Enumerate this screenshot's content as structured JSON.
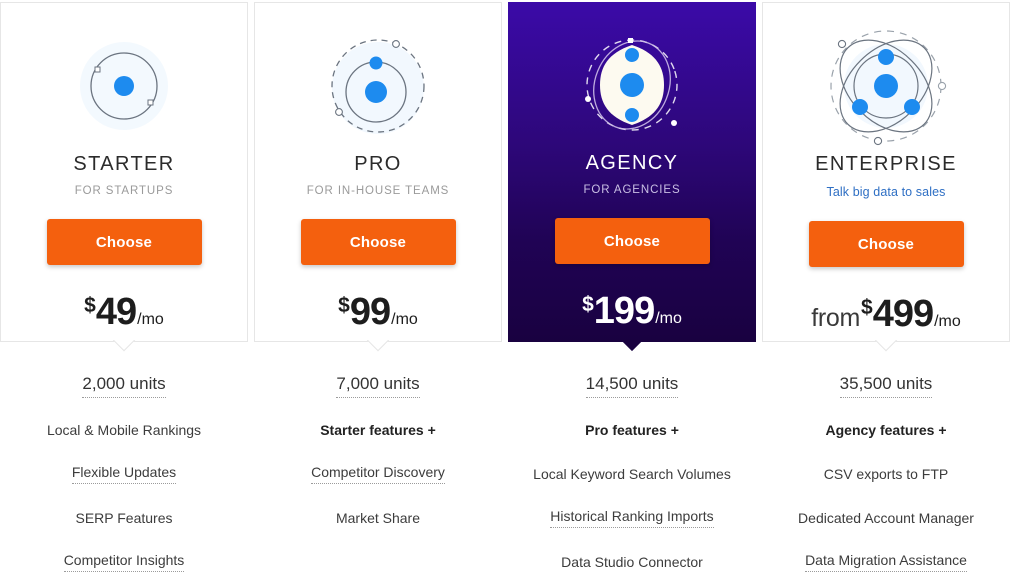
{
  "plans": [
    {
      "id": "starter",
      "icon": "atom-1-electron-icon",
      "name": "STARTER",
      "tagline": "FOR STARTUPS",
      "tagline_is_link": false,
      "cta": "Choose",
      "price_from": "",
      "currency": "$",
      "amount": "49",
      "period": "/mo",
      "featured": false,
      "features": [
        {
          "text": "2,000 units",
          "style": "units",
          "tooltip": true
        },
        {
          "text": "Local & Mobile Rankings",
          "style": "normal",
          "tooltip": false
        },
        {
          "text": "Flexible Updates",
          "style": "normal",
          "tooltip": true
        },
        {
          "text": "SERP Features",
          "style": "normal",
          "tooltip": false
        },
        {
          "text": "Competitor Insights",
          "style": "normal",
          "tooltip": true
        }
      ]
    },
    {
      "id": "pro",
      "icon": "atom-2-orbit-icon",
      "name": "PRO",
      "tagline": "FOR IN-HOUSE TEAMS",
      "tagline_is_link": false,
      "cta": "Choose",
      "price_from": "",
      "currency": "$",
      "amount": "99",
      "period": "/mo",
      "featured": false,
      "features": [
        {
          "text": "7,000 units",
          "style": "units",
          "tooltip": true
        },
        {
          "text": "Starter features +",
          "style": "bold",
          "tooltip": false
        },
        {
          "text": "Competitor Discovery",
          "style": "normal",
          "tooltip": true
        },
        {
          "text": "Market Share",
          "style": "normal",
          "tooltip": false
        }
      ]
    },
    {
      "id": "agency",
      "icon": "atom-nucleus-glow-icon",
      "name": "AGENCY",
      "tagline": "FOR AGENCIES",
      "tagline_is_link": false,
      "cta": "Choose",
      "price_from": "",
      "currency": "$",
      "amount": "199",
      "period": "/mo",
      "featured": true,
      "features": [
        {
          "text": "14,500 units",
          "style": "units",
          "tooltip": true
        },
        {
          "text": "Pro features +",
          "style": "bold",
          "tooltip": false
        },
        {
          "text": "Local Keyword Search Volumes",
          "style": "normal",
          "tooltip": false
        },
        {
          "text": "Historical Ranking Imports",
          "style": "normal",
          "tooltip": true
        },
        {
          "text": "Data Studio Connector",
          "style": "normal",
          "tooltip": false
        }
      ]
    },
    {
      "id": "enterprise",
      "icon": "atom-multi-orbit-icon",
      "name": "ENTERPRISE",
      "tagline": "Talk big data to sales",
      "tagline_is_link": true,
      "cta": "Choose",
      "price_from": "from",
      "currency": "$",
      "amount": "499",
      "period": "/mo",
      "featured": false,
      "features": [
        {
          "text": "35,500 units",
          "style": "units",
          "tooltip": true
        },
        {
          "text": "Agency features +",
          "style": "bold",
          "tooltip": false
        },
        {
          "text": "CSV exports to FTP",
          "style": "normal",
          "tooltip": false
        },
        {
          "text": "Dedicated Account Manager",
          "style": "normal",
          "tooltip": false
        },
        {
          "text": "Data Migration Assistance",
          "style": "normal",
          "tooltip": true
        }
      ]
    }
  ],
  "colors": {
    "cta_orange": "#f4600e",
    "featured_purple_top": "#3b0aa8",
    "featured_purple_bottom": "#190140",
    "link_blue": "#2e6fc4",
    "electron_blue": "#1d8bef"
  }
}
